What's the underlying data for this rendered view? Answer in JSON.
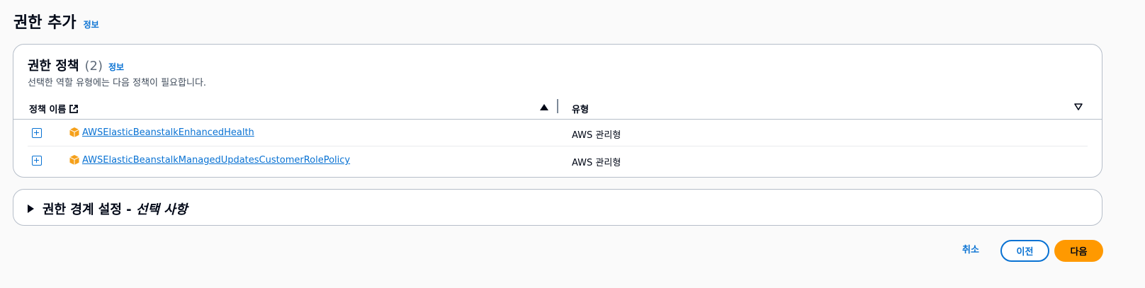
{
  "header": {
    "title": "권한 추가",
    "info_label": "정보"
  },
  "policies": {
    "title": "권한 정책",
    "count": "(2)",
    "info_label": "정보",
    "description": "선택한 역할 유형에는 다음 정책이 필요합니다.",
    "columns": {
      "name": "정책 이름",
      "type": "유형"
    },
    "rows": [
      {
        "name": "AWSElasticBeanstalkEnhancedHealth",
        "type": "AWS 관리형"
      },
      {
        "name": "AWSElasticBeanstalkManagedUpdatesCustomerRolePolicy",
        "type": "AWS 관리형"
      }
    ]
  },
  "boundary": {
    "title": "권한 경계 설정 - ",
    "title_optional": "선택 사항"
  },
  "actions": {
    "cancel": "취소",
    "previous": "이전",
    "next": "다음"
  },
  "colors": {
    "link": "#0972d3",
    "primary_button": "#ff9900",
    "aws_icon": "#f5a01a"
  }
}
